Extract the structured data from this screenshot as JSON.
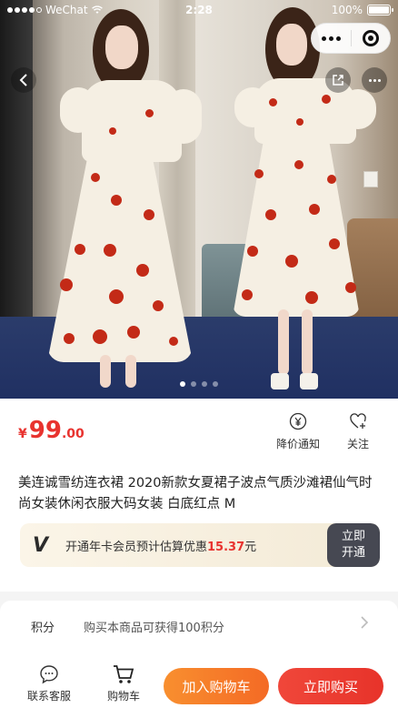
{
  "status_bar": {
    "carrier": "WeChat",
    "time": "2:28",
    "battery": "100%"
  },
  "capsule": {
    "more_icon": "more-dots-icon",
    "close_icon": "close-circle-icon"
  },
  "gallery": {
    "page_count": 4,
    "active_page": 1
  },
  "product": {
    "price_symbol": "¥",
    "price_integer": "99",
    "price_decimal": ".00",
    "title": "美连诚雪纺连衣裙 2020新款女夏裙子波点气质沙滩裙仙气时尚女装休闲衣服大码女装 白底红点 M"
  },
  "actions": {
    "price_alert_label": "降价通知",
    "follow_label": "关注"
  },
  "vip": {
    "logo": "V",
    "text_prefix": "开通年卡会员预计估算优惠",
    "discount": "15.37",
    "text_suffix": "元",
    "button_line1": "立即",
    "button_line2": "开通"
  },
  "points": {
    "label": "积分",
    "description": "购买本商品可获得100积分"
  },
  "bottom_bar": {
    "service_label": "联系客服",
    "cart_label": "购物车",
    "add_to_cart_label": "加入购物车",
    "buy_now_label": "立即购买"
  },
  "colors": {
    "price": "#e8332f",
    "add_to_cart": "#f46a25",
    "buy_now": "#e7332a",
    "vip_button": "#464852"
  }
}
